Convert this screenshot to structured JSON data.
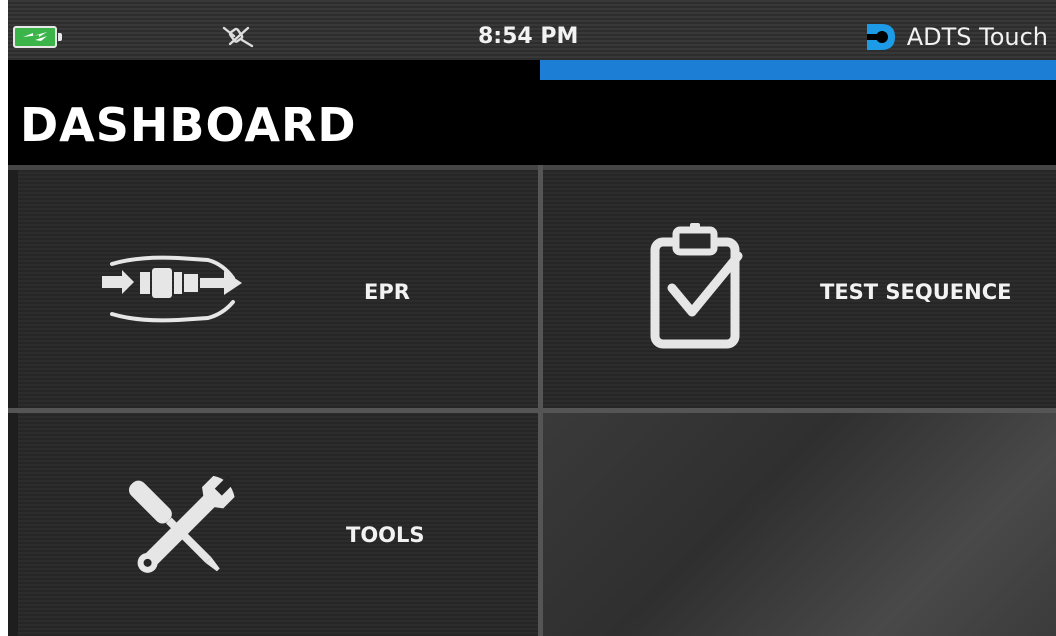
{
  "status_bar": {
    "time": "8:54 PM",
    "brand_name": "ADTS Touch",
    "battery_icon": "battery-charging-icon",
    "connection_icon": "disconnected-plug-icon",
    "accent_color": "#1d7ed6",
    "progress_fraction": 1.0
  },
  "header": {
    "title": "DASHBOARD"
  },
  "tiles": [
    {
      "label": "EPR",
      "icon": "epr-engine-icon"
    },
    {
      "label": "TEST SEQUENCE",
      "icon": "clipboard-check-icon"
    },
    {
      "label": "TOOLS",
      "icon": "wrench-screwdriver-icon"
    }
  ]
}
